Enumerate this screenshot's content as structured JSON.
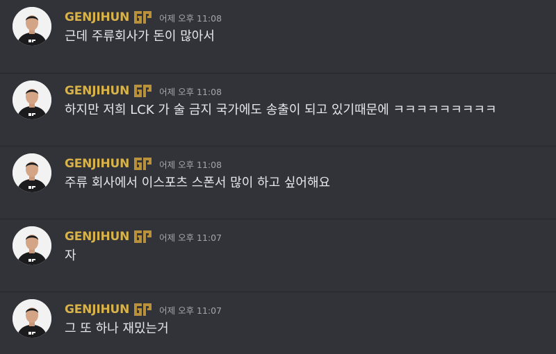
{
  "colors": {
    "background": "#313338",
    "username": "#d8b24a",
    "timestamp": "#a3a6aa",
    "text": "#e6e7ea"
  },
  "messages": [
    {
      "username": "GENJIHUN",
      "badge_icon": "team-logo-icon",
      "timestamp": "어제 오후 11:08",
      "content": "근데 주류회사가 돈이 많아서"
    },
    {
      "username": "GENJIHUN",
      "badge_icon": "team-logo-icon",
      "timestamp": "어제 오후 11:08",
      "content": "하지만 저희 LCK 가 술 금지 국가에도 송출이 되고 있기때문에 ㅋㅋㅋㅋㅋㅋㅋㅋㅋ"
    },
    {
      "username": "GENJIHUN",
      "badge_icon": "team-logo-icon",
      "timestamp": "어제 오후 11:08",
      "content": "주류 회사에서 이스포츠 스폰서 많이 하고 싶어해요"
    },
    {
      "username": "GENJIHUN",
      "badge_icon": "team-logo-icon",
      "timestamp": "어제 오후 11:07",
      "content": "자"
    },
    {
      "username": "GENJIHUN",
      "badge_icon": "team-logo-icon",
      "timestamp": "어제 오후 11:07",
      "content": "그 또 하나 재밌는거"
    }
  ]
}
